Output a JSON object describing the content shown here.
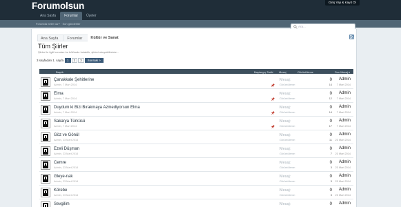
{
  "header": {
    "logo": "Forumolsun",
    "login_label": "Giriş Yap & Kayıt Ol",
    "nav": [
      {
        "label": "Ana Sayfa",
        "active": false
      },
      {
        "label": "Forumlar",
        "active": true
      },
      {
        "label": "Üyeler",
        "active": false
      }
    ],
    "subbar_text": "Forumda neler var? · Son gönderiler",
    "search_placeholder": "Ara..."
  },
  "breadcrumbs": [
    "Ana Sayfa",
    "Forumlar",
    "Kültür ve Sanat"
  ],
  "page": {
    "title": "Tüm Şiirler",
    "description": "Şiirler ile ilgili konuları bu bölümde bulabilir, şiirleri okuyabilirsiniz..."
  },
  "pager": {
    "label": "3 sayfadan 1. sayfa",
    "pages": [
      "1",
      "2",
      "3"
    ],
    "current": "1",
    "next_label": "Sonraki >"
  },
  "table_headers": {
    "title": "Başlık",
    "start_date": "Başlangıç Tarihi",
    "messages": "Mesaj",
    "views": "Görüntüleme",
    "last_message": "Son Mesaj ▾"
  },
  "row_labels": {
    "messages": "Mesaj:",
    "views": "Görüntüleme:"
  },
  "topics": [
    {
      "title": "Çanakkale Şehitlerine",
      "meta": "Admin, 7 Mart 2014",
      "pinned": true,
      "messages": "0",
      "views": "14",
      "last_user": "Admin",
      "last_date": "7 Mart 2014"
    },
    {
      "title": "Elma",
      "meta": "Admin, 7 Mart 2014",
      "pinned": true,
      "messages": "0",
      "views": "12",
      "last_user": "Admin",
      "last_date": "7 Mart 2014"
    },
    {
      "title": "Duydum ki Bizi Bırakmaya Azmediyorsun Elma",
      "meta": "Admin, 7 Mart 2014",
      "pinned": true,
      "messages": "0",
      "views": "14",
      "last_user": "Admin",
      "last_date": "7 Mart 2014"
    },
    {
      "title": "Sakarya Türküsü",
      "meta": "Admin, 7 Mart 2014",
      "pinned": true,
      "messages": "0",
      "views": "17",
      "last_user": "Admin",
      "last_date": "7 Mart 2014"
    },
    {
      "title": "Göz ve Gönül",
      "meta": "Admin, 23 Mart 2014",
      "pinned": false,
      "messages": "0",
      "views": "11",
      "last_user": "Admin",
      "last_date": "23 Mart 2014"
    },
    {
      "title": "Ezeli Düşman",
      "meta": "Admin, 23 Mart 2014",
      "pinned": false,
      "messages": "0",
      "views": "7",
      "last_user": "Admin",
      "last_date": "23 Mart 2014"
    },
    {
      "title": "Cemre",
      "meta": "Admin, 23 Mart 2014",
      "pinned": false,
      "messages": "0",
      "views": "3",
      "last_user": "Admin",
      "last_date": "23 Mart 2014"
    },
    {
      "title": "Gleye-nak",
      "meta": "Admin, 23 Mart 2014",
      "pinned": false,
      "messages": "0",
      "views": "3",
      "last_user": "Admin",
      "last_date": "23 Mart 2014"
    },
    {
      "title": "Körebe",
      "meta": "Admin, 23 Mart 2014",
      "pinned": false,
      "messages": "0",
      "views": "3",
      "last_user": "Admin",
      "last_date": "23 Mart 2014"
    },
    {
      "title": "Sevgilim",
      "meta": "Admin, 23 Mart 2014",
      "pinned": false,
      "messages": "0",
      "views": "3",
      "last_user": "Admin",
      "last_date": "23 Mart 2014"
    }
  ],
  "colors": {
    "header_bg": "#1f2d38",
    "table_header_bg": "#3d4f5d",
    "accent": "#3a5a78",
    "pin": "#c0392b"
  },
  "icons": {
    "search": "search-icon",
    "rss": "rss-icon",
    "pin": "pin-icon",
    "avatar": "avatar"
  }
}
